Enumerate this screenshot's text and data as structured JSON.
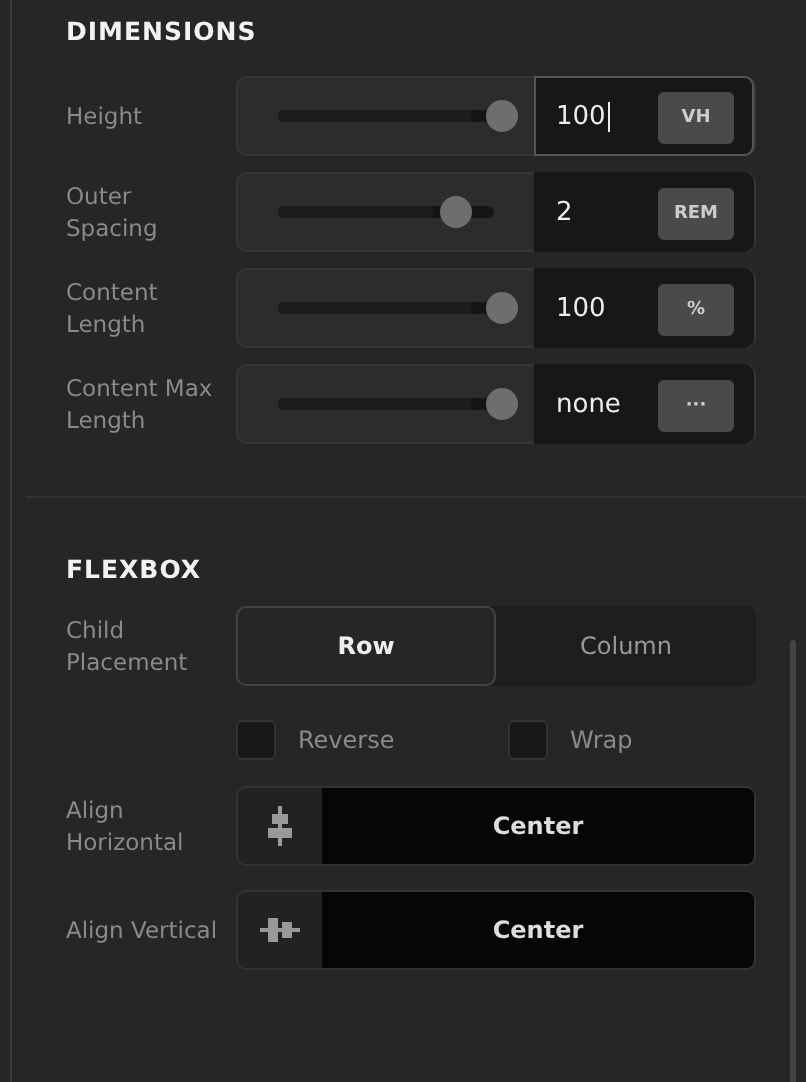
{
  "dimensions": {
    "title": "DIMENSIONS",
    "rows": [
      {
        "label": "Height",
        "level": 0.9,
        "value": "100",
        "unit": "VH",
        "focused": true
      },
      {
        "label": "Outer Spacing",
        "level": 0.72,
        "value": "2",
        "unit": "REM",
        "focused": false
      },
      {
        "label": "Content Length",
        "level": 0.9,
        "value": "100",
        "unit": "%",
        "focused": false
      },
      {
        "label": "Content Max Length",
        "level": 0.9,
        "value": "none",
        "unit": "···",
        "focused": false
      }
    ]
  },
  "flexbox": {
    "title": "FLEXBOX",
    "placement": {
      "label": "Child Placement",
      "options": [
        {
          "label": "Row",
          "selected": true
        },
        {
          "label": "Column",
          "selected": false
        }
      ]
    },
    "checkboxes": [
      {
        "label": "Reverse",
        "checked": false
      },
      {
        "label": "Wrap",
        "checked": false
      }
    ],
    "aligns": [
      {
        "label": "Align Horizontal",
        "kind": "horizontal",
        "value": "Center"
      },
      {
        "label": "Align Vertical",
        "kind": "vertical",
        "value": "Center"
      }
    ]
  }
}
